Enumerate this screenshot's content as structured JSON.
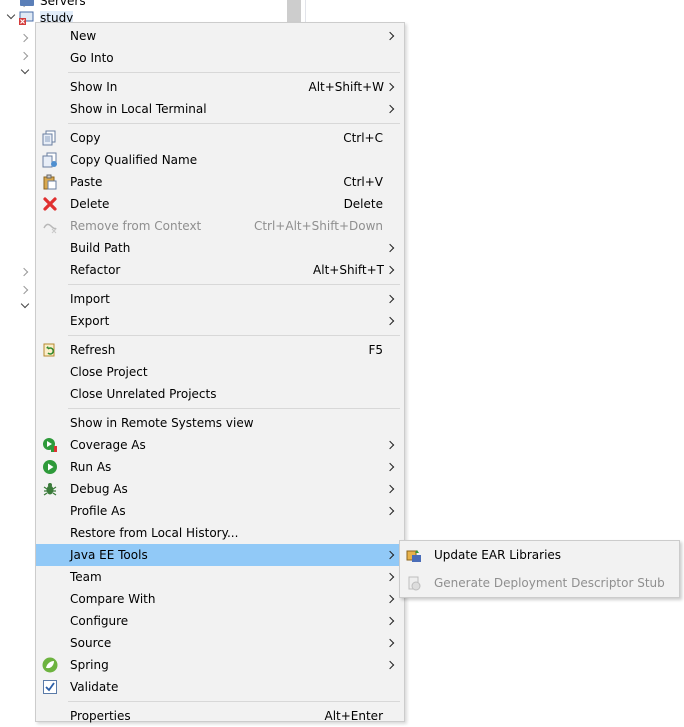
{
  "tree": {
    "servers_label": "Servers",
    "project_label": "study"
  },
  "menu": {
    "items": [
      {
        "label": "New",
        "shortcut": "",
        "submenu": true,
        "icon": ""
      },
      {
        "label": "Go Into",
        "shortcut": "",
        "submenu": false,
        "icon": ""
      },
      {
        "label": "Show In",
        "shortcut": "Alt+Shift+W",
        "submenu": true,
        "icon": ""
      },
      {
        "label": "Show in Local Terminal",
        "shortcut": "",
        "submenu": true,
        "icon": ""
      },
      {
        "label": "Copy",
        "shortcut": "Ctrl+C",
        "submenu": false,
        "icon": "copy-icon"
      },
      {
        "label": "Copy Qualified Name",
        "shortcut": "",
        "submenu": false,
        "icon": "copy-qualified-name-icon"
      },
      {
        "label": "Paste",
        "shortcut": "Ctrl+V",
        "submenu": false,
        "icon": "paste-icon"
      },
      {
        "label": "Delete",
        "shortcut": "Delete",
        "submenu": false,
        "icon": "delete-icon"
      },
      {
        "label": "Remove from Context",
        "shortcut": "Ctrl+Alt+Shift+Down",
        "submenu": false,
        "icon": "remove-context-icon",
        "disabled": true
      },
      {
        "label": "Build Path",
        "shortcut": "",
        "submenu": true,
        "icon": ""
      },
      {
        "label": "Refactor",
        "shortcut": "Alt+Shift+T",
        "submenu": true,
        "icon": ""
      },
      {
        "label": "Import",
        "shortcut": "",
        "submenu": true,
        "icon": ""
      },
      {
        "label": "Export",
        "shortcut": "",
        "submenu": true,
        "icon": ""
      },
      {
        "label": "Refresh",
        "shortcut": "F5",
        "submenu": false,
        "icon": "refresh-icon"
      },
      {
        "label": "Close Project",
        "shortcut": "",
        "submenu": false,
        "icon": ""
      },
      {
        "label": "Close Unrelated Projects",
        "shortcut": "",
        "submenu": false,
        "icon": ""
      },
      {
        "label": "Show in Remote Systems view",
        "shortcut": "",
        "submenu": false,
        "icon": ""
      },
      {
        "label": "Coverage As",
        "shortcut": "",
        "submenu": true,
        "icon": "coverage-icon"
      },
      {
        "label": "Run As",
        "shortcut": "",
        "submenu": true,
        "icon": "run-icon"
      },
      {
        "label": "Debug As",
        "shortcut": "",
        "submenu": true,
        "icon": "debug-icon"
      },
      {
        "label": "Profile As",
        "shortcut": "",
        "submenu": true,
        "icon": ""
      },
      {
        "label": "Restore from Local History...",
        "shortcut": "",
        "submenu": false,
        "icon": ""
      },
      {
        "label": "Java EE Tools",
        "shortcut": "",
        "submenu": true,
        "icon": "",
        "selected": true
      },
      {
        "label": "Team",
        "shortcut": "",
        "submenu": true,
        "icon": ""
      },
      {
        "label": "Compare With",
        "shortcut": "",
        "submenu": true,
        "icon": ""
      },
      {
        "label": "Configure",
        "shortcut": "",
        "submenu": true,
        "icon": ""
      },
      {
        "label": "Source",
        "shortcut": "",
        "submenu": true,
        "icon": ""
      },
      {
        "label": "Spring",
        "shortcut": "",
        "submenu": true,
        "icon": "spring-icon"
      },
      {
        "label": "Validate",
        "shortcut": "",
        "submenu": false,
        "icon": "validate-checkbox-icon"
      },
      {
        "label": "Properties",
        "shortcut": "Alt+Enter",
        "submenu": false,
        "icon": ""
      }
    ]
  },
  "submenu": {
    "items": [
      {
        "label": "Update EAR Libraries",
        "icon": "update-ear-libraries-icon",
        "disabled": false
      },
      {
        "label": "Generate Deployment Descriptor Stub",
        "icon": "generate-descriptor-icon",
        "disabled": true
      }
    ]
  },
  "colors": {
    "menu_background": "#f2f2f2",
    "selection": "#91c9f7",
    "disabled_text": "#8f8f8f",
    "separator": "#d8d8d8"
  }
}
